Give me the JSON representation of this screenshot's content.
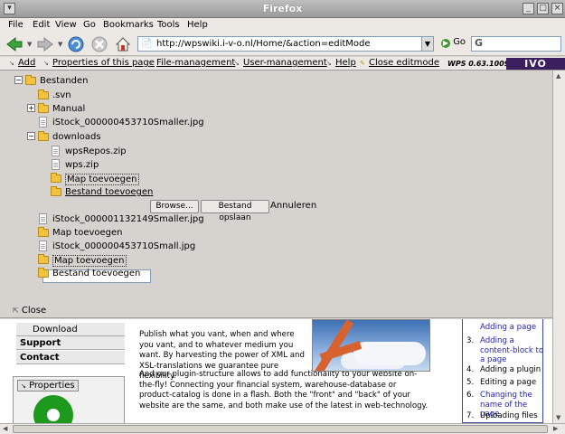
{
  "window": {
    "title": "Firefox"
  },
  "menu": [
    "File",
    "Edit",
    "View",
    "Go",
    "Bookmarks",
    "Tools",
    "Help"
  ],
  "nav": {
    "url": "http://wpswiki.i-v-o.nl/Home/&action=editMode",
    "go_label": "Go",
    "search_value": "G"
  },
  "wps_toolbar": {
    "items": [
      "Add",
      "Properties of this page",
      "File-management",
      "User-management",
      "Help",
      "Close editmode"
    ],
    "version": "WPS 0.63.1009",
    "logo": "IVO"
  },
  "tree": {
    "root": "Bestanden",
    "items": [
      ".svn",
      "Manual",
      "iStock_000000453710Smaller.jpg",
      "downloads",
      "wpsRepos.zip",
      "wps.zip",
      "Map toevoegen",
      "Bestand toevoegen",
      "iStock_000001132149Smaller.jpg",
      "Map toevoegen",
      "iStock_000000453710Small.jpg",
      "Map toevoegen",
      "Bestand toevoegen"
    ],
    "browse_label": "Browse...",
    "save_label": "Bestand opslaan",
    "cancel_label": "Annuleren",
    "close_label": "Close"
  },
  "page": {
    "left_links": [
      "Download",
      "Support",
      "Contact"
    ],
    "properties_label": "Properties",
    "p1": "Publish what you vant, when and where you vant, and to whatever medium you want. By harvesting the power of XML and XSL-translations we guarantee pure flexibility.",
    "p2": "And our plugin-structure allows to add functionality to your website on-the-fly! Connecting your financial system, warehouse-database or product-catalog is done in a flash. Both the \"front\" and \"back\" of your website are the same, and both make use of the latest in web-technology.",
    "steps": [
      {
        "n": "",
        "t": "Adding a page"
      },
      {
        "n": "3.",
        "t": "Adding a content-block to a page"
      },
      {
        "n": "4.",
        "t": "Adding a plugin"
      },
      {
        "n": "5.",
        "t": "Editing a page"
      },
      {
        "n": "6.",
        "t": "Changing the name of the page"
      },
      {
        "n": "7.",
        "t": "Uploading files"
      }
    ]
  },
  "icons": [
    "back-icon",
    "forward-icon",
    "reload-icon",
    "stop-icon",
    "home-icon",
    "go-icon",
    "folder-icon",
    "file-icon"
  ]
}
